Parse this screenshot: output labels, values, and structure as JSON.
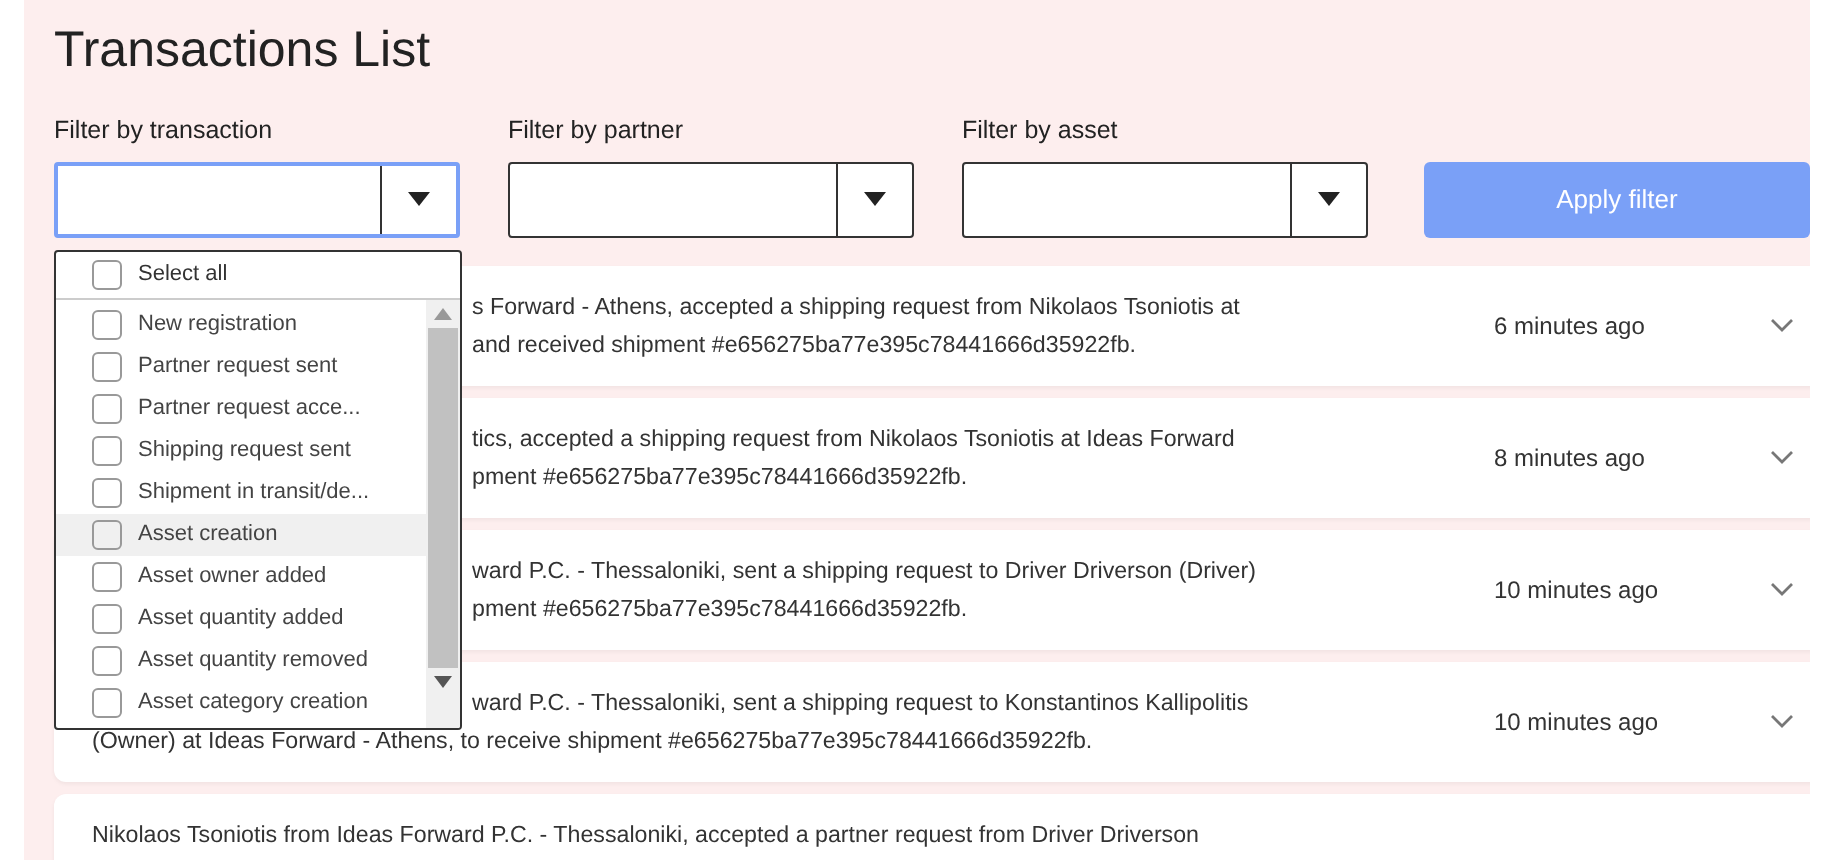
{
  "title": "Transactions List",
  "filters": [
    {
      "label": "Filter by transaction",
      "open": true
    },
    {
      "label": "Filter by partner",
      "open": false
    },
    {
      "label": "Filter by asset",
      "open": false
    }
  ],
  "apply_button": {
    "label": "Apply filter",
    "disabled": true
  },
  "dropdown": {
    "select_all": {
      "label": "Select all",
      "checked": false
    },
    "options": [
      {
        "label": "New registration",
        "checked": false,
        "hovered": false
      },
      {
        "label": "Partner request sent",
        "checked": false,
        "hovered": false
      },
      {
        "label": "Partner request acce...",
        "checked": false,
        "hovered": false
      },
      {
        "label": "Shipping request sent",
        "checked": false,
        "hovered": false
      },
      {
        "label": "Shipment in transit/de...",
        "checked": false,
        "hovered": false
      },
      {
        "label": "Asset creation",
        "checked": false,
        "hovered": true
      },
      {
        "label": "Asset owner added",
        "checked": false,
        "hovered": false
      },
      {
        "label": "Asset quantity added",
        "checked": false,
        "hovered": false
      },
      {
        "label": "Asset quantity removed",
        "checked": false,
        "hovered": false
      },
      {
        "label": "Asset category creation",
        "checked": false,
        "hovered": false
      }
    ]
  },
  "transactions": [
    {
      "lines": [
        {
          "text": "s Forward - Athens, accepted a shipping request from Nikolaos Tsoniotis at",
          "covered": true
        },
        {
          "text": "and received shipment #e656275ba77e395c78441666d35922fb.",
          "covered": true
        }
      ],
      "time": "6 minutes ago",
      "expanded": false
    },
    {
      "lines": [
        {
          "text": "tics, accepted a shipping request from Nikolaos Tsoniotis at Ideas Forward",
          "covered": true
        },
        {
          "text": "pment #e656275ba77e395c78441666d35922fb.",
          "covered": true
        }
      ],
      "time": "8 minutes ago",
      "expanded": false
    },
    {
      "lines": [
        {
          "text": "ward P.C. - Thessaloniki, sent a shipping request to Driver Driverson (Driver)",
          "covered": true
        },
        {
          "text": "pment #e656275ba77e395c78441666d35922fb.",
          "covered": true
        }
      ],
      "time": "10 minutes ago",
      "expanded": false
    },
    {
      "lines": [
        {
          "text": "ward P.C. - Thessaloniki, sent a shipping request to Konstantinos Kallipolitis",
          "covered": true
        },
        {
          "text": "(Owner) at Ideas Forward - Athens, to receive shipment #e656275ba77e395c78441666d35922fb."
        }
      ],
      "time": "10 minutes ago",
      "expanded": false
    },
    {
      "lines": [
        {
          "text": "Nikolaos Tsoniotis from Ideas Forward P.C. - Thessaloniki, accepted a partner request from Driver Driverson"
        }
      ]
    }
  ]
}
